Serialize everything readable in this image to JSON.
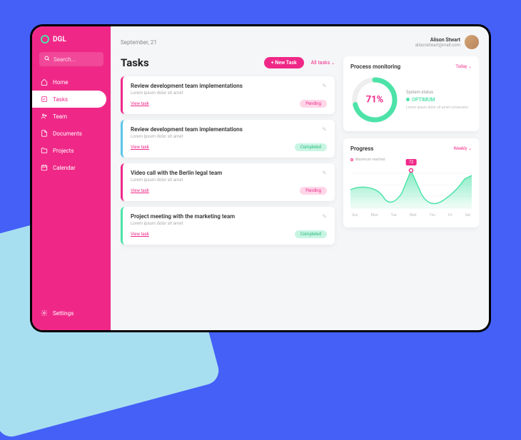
{
  "brand": "DGL",
  "search": {
    "placeholder": "Search..."
  },
  "sidebar": {
    "items": [
      {
        "label": "Home",
        "icon": "home-icon"
      },
      {
        "label": "Tasks",
        "icon": "checklist-icon",
        "active": true
      },
      {
        "label": "Team",
        "icon": "team-icon"
      },
      {
        "label": "Documents",
        "icon": "document-icon"
      },
      {
        "label": "Projects",
        "icon": "folder-icon"
      },
      {
        "label": "Calendar",
        "icon": "calendar-icon"
      }
    ],
    "footer": {
      "label": "Settings",
      "icon": "gear-icon"
    }
  },
  "header": {
    "date": "September, 21",
    "user": {
      "name": "Alison Stwart",
      "email": "alisonstwart@mail.com"
    }
  },
  "tasks": {
    "title": "Tasks",
    "new_button": "+ New Task",
    "filter": "All tasks",
    "view_label": "View task",
    "items": [
      {
        "title": "Review development team implementations",
        "desc": "Lorem ipsum dolor sit amet",
        "status": "Pending",
        "accent": "#ef2888"
      },
      {
        "title": "Review development team implementations",
        "desc": "Lorem ipsum dolor sit amet",
        "status": "Completed",
        "accent": "#5bc5e8"
      },
      {
        "title": "Video call with the Berlin legal team",
        "desc": "Lorem ipsum dolor sit amet",
        "status": "Pending",
        "accent": "#ef2888"
      },
      {
        "title": "Project meeting with the marketing team",
        "desc": "Lorem ipsum dolor sit amet",
        "status": "Completed",
        "accent": "#4de3a8"
      }
    ]
  },
  "process": {
    "title": "Process monitoring",
    "filter": "Today",
    "percent": "71%",
    "status_label": "System status",
    "status_value": "OPTIMUM",
    "status_desc": "Lorem ipsum dolor sit amet consecetur"
  },
  "progress": {
    "title": "Progress",
    "filter": "Weekly",
    "legend": "Maximum reached",
    "peak": "72"
  },
  "chart_data": {
    "type": "area",
    "title": "Progress",
    "categories": [
      "Sun",
      "Mon",
      "Tue",
      "Wed",
      "Thu",
      "Fri",
      "Sat"
    ],
    "values": [
      42,
      40,
      18,
      72,
      15,
      30,
      60
    ],
    "peak_index": 3,
    "peak_value": 72,
    "ylim": [
      0,
      80
    ],
    "xlabel": "",
    "ylabel": "",
    "legend": [
      "Maximum reached"
    ],
    "colors": {
      "fill": "#4de3a8",
      "peak_marker": "#ef2888"
    }
  },
  "colors": {
    "accent": "#ef2888",
    "success": "#4de3a8",
    "info": "#5bc5e8",
    "bg": "#4460f7"
  }
}
